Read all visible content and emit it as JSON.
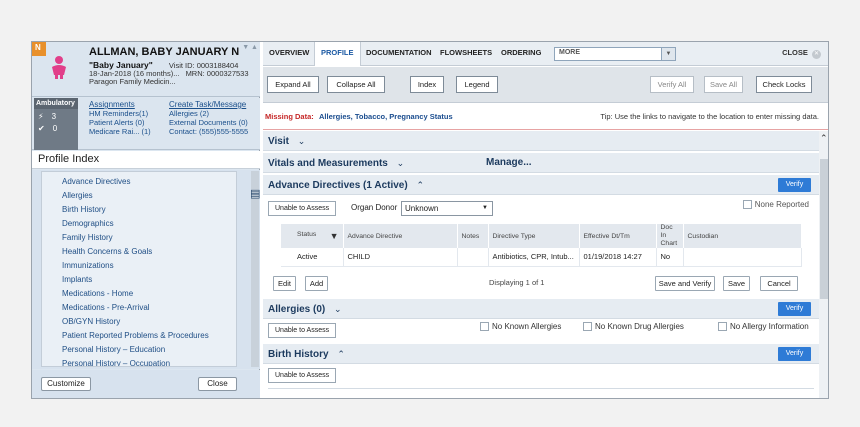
{
  "banner": {
    "flag": "N",
    "patient_name": "ALLMAN, BABY JANUARY N",
    "nickname": "\"Baby January\"",
    "visit_id": "Visit ID: 0003188404",
    "dob": "18-Jan-2018 (16 months)...",
    "mrn": "MRN: 0000327533",
    "practice": "Paragon Family Medicin..."
  },
  "ambulatory": {
    "tag": "Ambulatory",
    "count1": "3",
    "count2": "0",
    "assignments": "Assignments",
    "create_task": "Create Task/Message",
    "hm_reminders": "HM Reminders(1)",
    "patient_alerts": "Patient Alerts (0)",
    "medicare": "Medicare Rai... (1)",
    "allergies": "Allergies (2)",
    "external_docs": "External Documents (0)",
    "contact": "Contact: (555)555-5555"
  },
  "profile_index": {
    "title": "Profile Index",
    "items": [
      "Advance Directives",
      "Allergies",
      "Birth History",
      "Demographics",
      "Family History",
      "Health Concerns & Goals",
      "Immunizations",
      "Implants",
      "Medications - Home",
      "Medications - Pre-Arrival",
      "OB/GYN History",
      "Patient Reported Problems & Procedures",
      "Personal History – Education",
      "Personal History – Occupation"
    ],
    "customize": "Customize",
    "close": "Close"
  },
  "tabs": [
    "OVERVIEW",
    "PROFILE",
    "DOCUMENTATION",
    "FLOWSHEETS",
    "ORDERING"
  ],
  "more": "MORE",
  "close_label": "CLOSE",
  "toolbar": {
    "expand_all": "Expand All",
    "collapse_all": "Collapse All",
    "index": "Index",
    "legend": "Legend",
    "verify_all": "Verify All",
    "save_all": "Save All",
    "check_locks": "Check Locks"
  },
  "missing": {
    "label": "Missing Data:",
    "links": "Allergies, Tobacco, Pregnancy Status",
    "tip": "Tip: Use the links to navigate to the location to enter missing data."
  },
  "sections": {
    "visit": "Visit",
    "vitals": "Vitals and Measurements",
    "manage": "Manage...",
    "advance": "Advance Directives (1 Active)",
    "allergies": "Allergies (0)",
    "birth": "Birth History",
    "verify": "Verify"
  },
  "advance": {
    "unable": "Unable to Assess",
    "organ_donor_label": "Organ Donor",
    "organ_donor_value": "Unknown",
    "none_reported": "None Reported",
    "columns": [
      "Status",
      "Advance Directive",
      "Notes",
      "Directive Type",
      "Effective Dt/Tm",
      "Doc In Chart",
      "Custodian"
    ],
    "row": [
      "Active",
      "CHILD",
      "",
      "Antibiotics, CPR, Intub...",
      "01/19/2018 14:27",
      "No",
      ""
    ],
    "edit": "Edit",
    "add": "Add",
    "displaying": "Displaying 1 of 1",
    "save_verify": "Save and Verify",
    "save": "Save",
    "cancel": "Cancel"
  },
  "allergies": {
    "unable": "Unable to Assess",
    "nka": "No Known Allergies",
    "nkda": "No Known Drug Allergies",
    "nai": "No Allergy Information"
  },
  "birth": {
    "unable": "Unable to Assess"
  }
}
